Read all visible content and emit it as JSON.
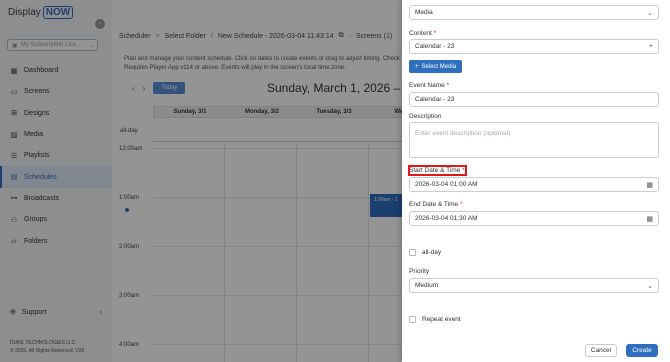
{
  "sidebar": {
    "logo_display": "Display",
    "logo_now": "NOW",
    "subscription_placeholder": "My Subscription Lice...",
    "items": [
      {
        "label": "Dashboard"
      },
      {
        "label": "Screens"
      },
      {
        "label": "Designs"
      },
      {
        "label": "Media"
      },
      {
        "label": "Playlists"
      },
      {
        "label": "Schedules"
      },
      {
        "label": "Broadcasts"
      },
      {
        "label": "Groups"
      },
      {
        "label": "Folders"
      }
    ],
    "support": "Support",
    "footer_company": "DUKE TECHNOLOGIES LLC",
    "footer_rights": "© 2026. All Rights Reserved. V26"
  },
  "breadcrumb": {
    "scheduler": "Scheduler",
    "select_folder": "Select Folder",
    "new_schedule": "New Schedule - 2026-03-04 11:43:14",
    "screens": "Screens (1)"
  },
  "info_text": "Plan and manage your content schedule. Click on dates to create events or drag to adjust timing. Check Requires Player App v114 or above. Events will play in the screen's local time zone.",
  "calendar": {
    "today": "Today",
    "date_title": "Sunday, March 1, 2026 – Sa",
    "days": [
      "Sunday, 3/1",
      "Monday, 3/2",
      "Tuesday, 3/3",
      "Wednes"
    ],
    "allday": "all-day",
    "times": [
      "12:00am",
      "1:00am",
      "2:00am",
      "3:00am",
      "4:00am"
    ],
    "event_label": "1:00am - 1"
  },
  "panel": {
    "media_type_value": "Media",
    "content_label": "Content",
    "content_value": "Calendar - 23",
    "select_media": "Select Media",
    "event_name_label": "Event Name",
    "event_name_value": "Calendar - 23",
    "description_label": "Description",
    "description_placeholder": "Enter event description (optional)",
    "start_label": "Start Date & Time",
    "start_value": "2026-03-04 01:00 AM",
    "end_label": "End Date & Time",
    "end_value": "2026-03-04 01:30 AM",
    "allday_label": "all-day",
    "priority_label": "Priority",
    "priority_value": "Medium",
    "repeat_label": "Repeat event",
    "cancel": "Cancel",
    "create": "Create",
    "required_mark": "*"
  },
  "colors": {
    "accent": "#2f6fc0",
    "highlight": "#e01818"
  }
}
